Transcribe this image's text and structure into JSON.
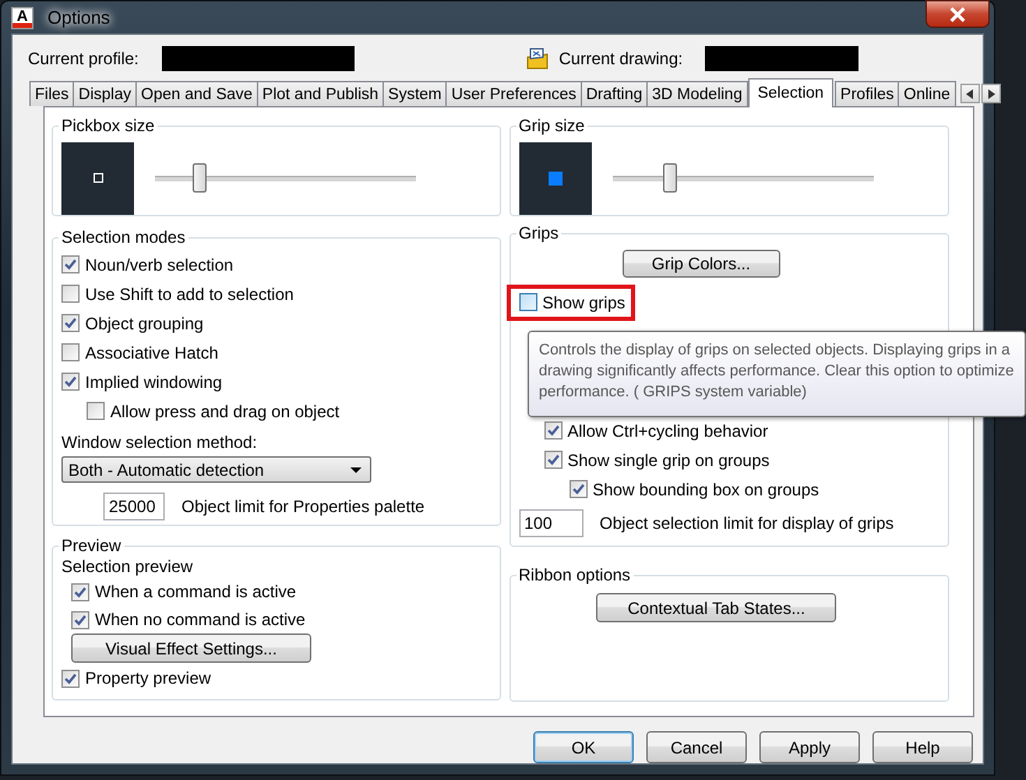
{
  "window": {
    "icon_letter": "A",
    "title": "Options"
  },
  "header": {
    "profile_label": "Current profile:",
    "drawing_label": "Current drawing:"
  },
  "tabs": [
    {
      "label": "Files",
      "selected": false
    },
    {
      "label": "Display",
      "selected": false
    },
    {
      "label": "Open and Save",
      "selected": false
    },
    {
      "label": "Plot and Publish",
      "selected": false
    },
    {
      "label": "System",
      "selected": false
    },
    {
      "label": "User Preferences",
      "selected": false
    },
    {
      "label": "Drafting",
      "selected": false
    },
    {
      "label": "3D Modeling",
      "selected": false
    },
    {
      "label": "Selection",
      "selected": true
    },
    {
      "label": "Profiles",
      "selected": false
    },
    {
      "label": "Online",
      "selected": false
    }
  ],
  "pickbox": {
    "title": "Pickbox size",
    "level": 0.17
  },
  "selection_modes": {
    "title": "Selection modes",
    "options": [
      {
        "label": "Noun/verb selection",
        "checked": true
      },
      {
        "label": "Use Shift to add to selection",
        "checked": false
      },
      {
        "label": "Object grouping",
        "checked": true
      },
      {
        "label": "Associative Hatch",
        "checked": false
      },
      {
        "label": "Implied windowing",
        "checked": true,
        "children": [
          {
            "label": "Allow press and drag on object",
            "checked": false
          }
        ]
      }
    ],
    "method_label": "Window selection method:",
    "method_value": "Both - Automatic detection",
    "limit_value": "25000",
    "limit_label": "Object limit for Properties palette"
  },
  "preview": {
    "title": "Preview",
    "subtitle": "Selection preview",
    "options": [
      {
        "label": "When a command is active",
        "checked": true
      },
      {
        "label": "When no command is active",
        "checked": true
      }
    ],
    "button": "Visual Effect Settings...",
    "property_preview": {
      "label": "Property preview",
      "checked": true
    }
  },
  "grip_size": {
    "title": "Grip size",
    "level": 0.22
  },
  "grips": {
    "title": "Grips",
    "button": "Grip Colors...",
    "show_grips": {
      "label": "Show grips",
      "checked": false,
      "highlighted": true
    },
    "options": [
      {
        "label": "Allow Ctrl+cycling behavior",
        "checked": true
      },
      {
        "label": "Show single grip on groups",
        "checked": true,
        "children": [
          {
            "label": "Show bounding box on groups",
            "checked": true
          }
        ]
      }
    ],
    "limit_value": "100",
    "limit_label": "Object selection limit for display of grips"
  },
  "tooltip": "Controls the display of grips on selected objects. Displaying grips in a drawing significantly affects performance. Clear this option to optimize performance. ( GRIPS system variable)",
  "ribbon": {
    "title": "Ribbon options",
    "button": "Contextual Tab States..."
  },
  "buttons": [
    {
      "label": "OK",
      "default": true
    },
    {
      "label": "Cancel",
      "default": false
    },
    {
      "label": "Apply",
      "default": false
    },
    {
      "label": "Help",
      "default": false
    }
  ]
}
